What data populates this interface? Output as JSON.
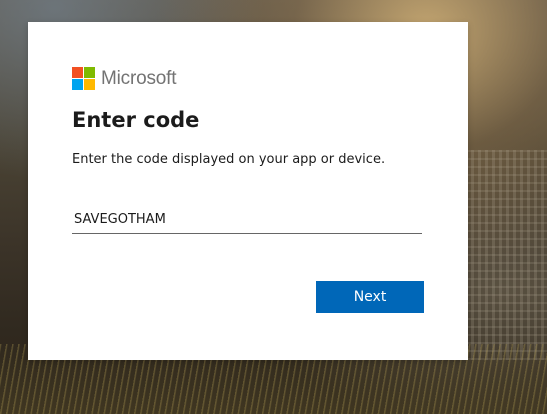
{
  "brand": {
    "name": "Microsoft",
    "logo_colors": [
      "#f25022",
      "#7fba00",
      "#00a4ef",
      "#ffb900"
    ]
  },
  "form": {
    "title": "Enter code",
    "description": "Enter the code displayed on your app or device.",
    "code_value": "SAVEGOTHAM",
    "next_label": "Next",
    "button_color": "#0067b8"
  }
}
